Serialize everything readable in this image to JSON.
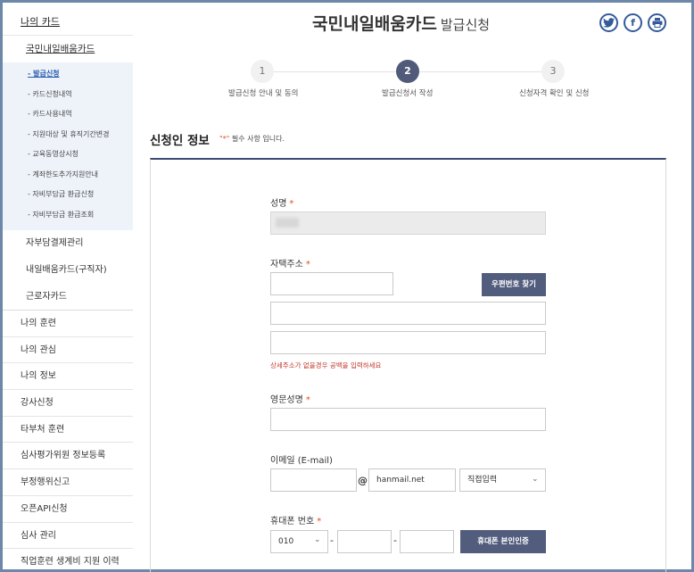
{
  "sidebar": {
    "top": "나의 카드",
    "sub1": "국민내일배움카드",
    "subs": [
      "- 발급신청",
      "- 카드신청내역",
      "- 카드사용내역",
      "- 지원대상 및 휴직기간변경",
      "- 교육동영상시청",
      "- 계좌한도추가지원안내",
      "- 자비부담금 환급신청",
      "- 자비부담금 환급조회"
    ],
    "level2": [
      "자부담결제관리",
      "내일배움카드(구직자)",
      "근로자카드"
    ],
    "level1": [
      "나의 훈련",
      "나의 관심",
      "나의 정보",
      "강사신청",
      "타부처 훈련",
      "심사평가위원 정보등록",
      "부정행위신고",
      "오픈API신청",
      "심사 관리",
      "직업훈련 생계비 지원 이력"
    ]
  },
  "header": {
    "title": "국민내일배움카드",
    "subtitle": "발급신청",
    "share": {
      "twitter": "twitter-icon",
      "facebook": "facebook-icon",
      "print": "print-icon"
    }
  },
  "steps": [
    {
      "num": "1",
      "label": "발급신청 안내 및 동의"
    },
    {
      "num": "2",
      "label": "발급신청서 작성"
    },
    {
      "num": "3",
      "label": "신청자격 확인 및 신청"
    }
  ],
  "section": {
    "title": "신청인 정보",
    "req_star": "\"*\"",
    "req_text": " 필수 사항 입니다."
  },
  "form": {
    "name_label": "성명",
    "address_label": "자택주소",
    "zip_button": "우편번호 찾기",
    "address_hint": "상세주소가 없을경우 공백을 입력하세요",
    "eng_name_label": "영문성명",
    "email_label": "이메일 (E-mail)",
    "email_at": "@",
    "email_domain": "hanmail.net",
    "email_select": "직접입력",
    "phone_label": "휴대폰 번호",
    "phone_prefix": "010",
    "phone_dash": "-",
    "phone_button": "휴대폰 본인인증",
    "star": "*"
  },
  "colors": {
    "accent": "#525d7d",
    "required": "#e04e1e",
    "hint": "#c0392b",
    "frame": "#6d87a8"
  }
}
